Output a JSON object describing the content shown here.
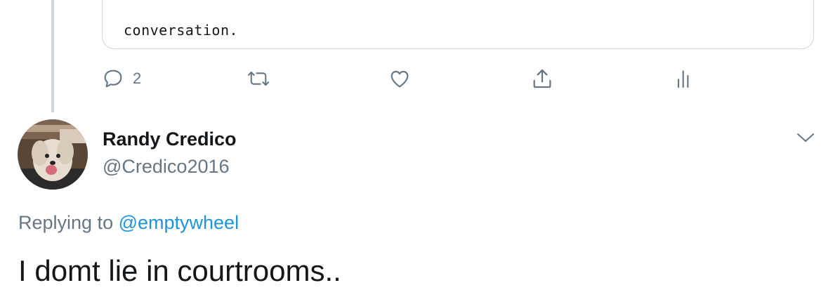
{
  "quoted_tweet": {
    "text_tail": "conversation."
  },
  "actions": {
    "reply_count": "2",
    "reply_icon": "speech-bubble-icon",
    "retweet_icon": "retweet-icon",
    "like_icon": "heart-icon",
    "share_icon": "share-icon",
    "analytics_icon": "bar-chart-icon"
  },
  "reply_tweet": {
    "author_name": "Randy Credico",
    "author_handle": "@Credico2016",
    "replying_label": "Replying to ",
    "replying_to": "@emptywheel",
    "text": "I domt lie in courtrooms.."
  },
  "colors": {
    "secondary_text": "#657786",
    "link": "#1b95e0",
    "border": "#ccd6dd",
    "primary_text": "#14171a"
  }
}
